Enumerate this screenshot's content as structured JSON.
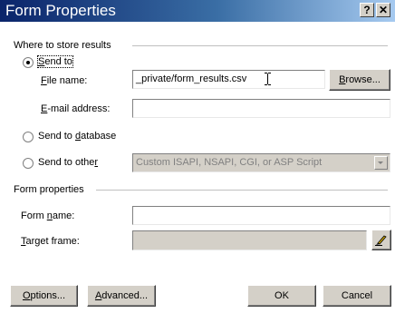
{
  "window": {
    "title": "Form Properties",
    "help_label": "?",
    "close_label": "✕"
  },
  "store_group": {
    "title": "Where to store results",
    "send_to": {
      "label": "Send to",
      "key": "S",
      "rest": "end to",
      "selected": true
    },
    "file_name": {
      "label_key": "F",
      "label_rest": "ile name:",
      "value": "_private/form_results.csv"
    },
    "browse_button": {
      "key": "B",
      "rest": "rowse..."
    },
    "email": {
      "label_key": "E",
      "label_rest": "-mail address:",
      "value": ""
    },
    "send_to_database": {
      "prefix": "Send to ",
      "key": "d",
      "rest": "atabase",
      "selected": false
    },
    "send_to_other": {
      "prefix": "Send to othe",
      "key": "r",
      "rest": "",
      "selected": false
    },
    "other_dropdown": {
      "value": "Custom ISAPI, NSAPI, CGI, or ASP Script",
      "icon": "chevron-down-icon"
    }
  },
  "form_group": {
    "title": "Form properties",
    "form_name": {
      "prefix": "Form ",
      "key": "n",
      "rest": "ame:",
      "value": ""
    },
    "target_frame": {
      "key": "T",
      "rest": "arget frame:",
      "value": "",
      "icon": "pencil-icon"
    }
  },
  "buttons": {
    "options": {
      "key": "O",
      "rest": "ptions..."
    },
    "advanced": {
      "key": "A",
      "rest": "dvanced..."
    },
    "ok": "OK",
    "cancel": "Cancel"
  },
  "colors": {
    "title_gradient_start": "#0a246a",
    "title_gradient_end": "#a6caf0",
    "face": "#d4d0c8"
  }
}
